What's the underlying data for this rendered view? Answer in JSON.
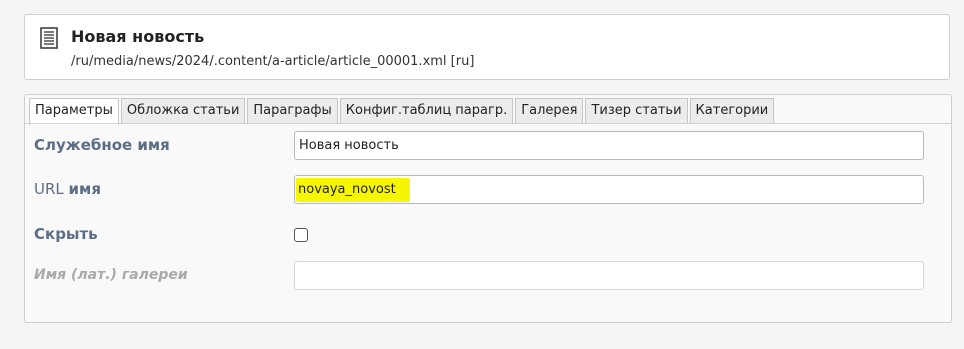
{
  "header": {
    "icon": "document-icon",
    "title": "Новая новость",
    "path": "/ru/media/news/2024/.content/a-article/article_00001.xml [ru]"
  },
  "tabs": [
    {
      "label": "Параметры",
      "active": true
    },
    {
      "label": "Обложка статьи",
      "active": false
    },
    {
      "label": "Параграфы",
      "active": false
    },
    {
      "label": "Конфиг.таблиц парагр.",
      "active": false
    },
    {
      "label": "Галерея",
      "active": false
    },
    {
      "label": "Тизер статьи",
      "active": false
    },
    {
      "label": "Категории",
      "active": false
    }
  ],
  "form": {
    "service_name": {
      "label": "Служебное имя",
      "value": "Новая новость"
    },
    "url_name": {
      "label": "URL имя",
      "value": "novaya_novost",
      "highlight_color": "#f6f600"
    },
    "hide": {
      "label": "Скрыть",
      "checked": false
    },
    "gallery_name": {
      "label": "Имя (лат.) галереи",
      "value": ""
    }
  },
  "colors": {
    "label": "#5b6e85",
    "disabled_label": "#a9a9a9",
    "highlight": "#f6f600"
  }
}
